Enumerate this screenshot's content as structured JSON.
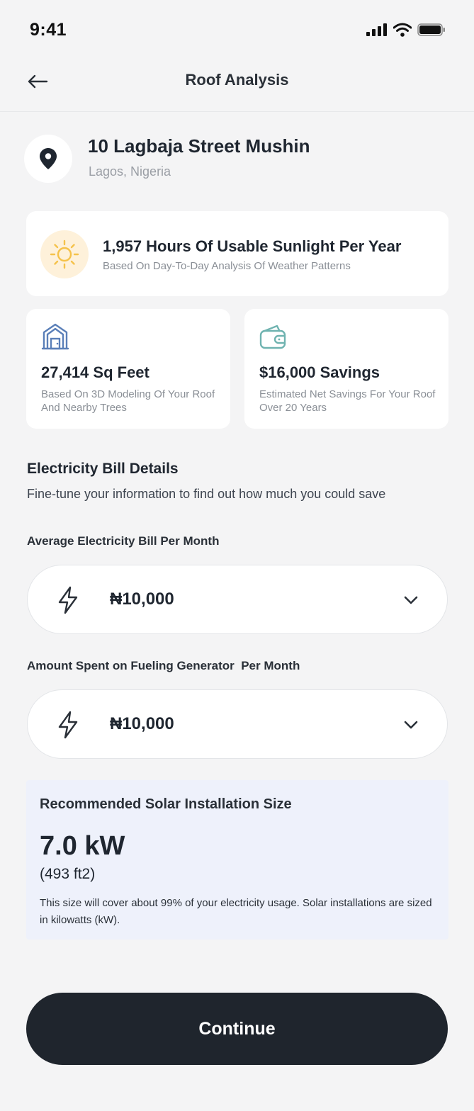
{
  "status_bar": {
    "time": "9:41"
  },
  "header": {
    "title": "Roof Analysis"
  },
  "location": {
    "street": "10 Lagbaja Street Mushin",
    "city": "Lagos, Nigeria"
  },
  "sunlight": {
    "title": "1,957 Hours Of Usable Sunlight Per Year",
    "subtitle": "Based On Day-To-Day Analysis Of Weather Patterns"
  },
  "stats": [
    {
      "value": "27,414 Sq Feet",
      "description": "Based On 3D Modeling Of Your Roof And Nearby Trees",
      "icon": "house-icon"
    },
    {
      "value": "$16,000 Savings",
      "description": "Estimated Net Savings For Your Roof Over 20 Years",
      "icon": "wallet-icon"
    }
  ],
  "bill_details": {
    "title": "Electricity Bill Details",
    "subtitle": "Fine-tune your information to find out how much you could save",
    "fields": [
      {
        "label": "Average Electricity Bill Per Month",
        "value": "₦10,000"
      },
      {
        "label": "Amount Spent on Fueling Generator  Per Month",
        "value": "₦10,000"
      }
    ]
  },
  "recommendation": {
    "title": "Recommended Solar Installation Size",
    "kw": "7.0 kW",
    "area": "(493 ft2)",
    "note": "This size will cover about 99% of your electricity usage. Solar installations are sized in kilowatts (kW)."
  },
  "continue_label": "Continue",
  "colors": {
    "background": "#F4F4F5",
    "primary_dark": "#1F252D",
    "sun_accent": "#F5C24A",
    "house_accent": "#5A7FB8",
    "wallet_accent": "#6FB3B0",
    "recommendation_bg": "#EEF1FB"
  }
}
